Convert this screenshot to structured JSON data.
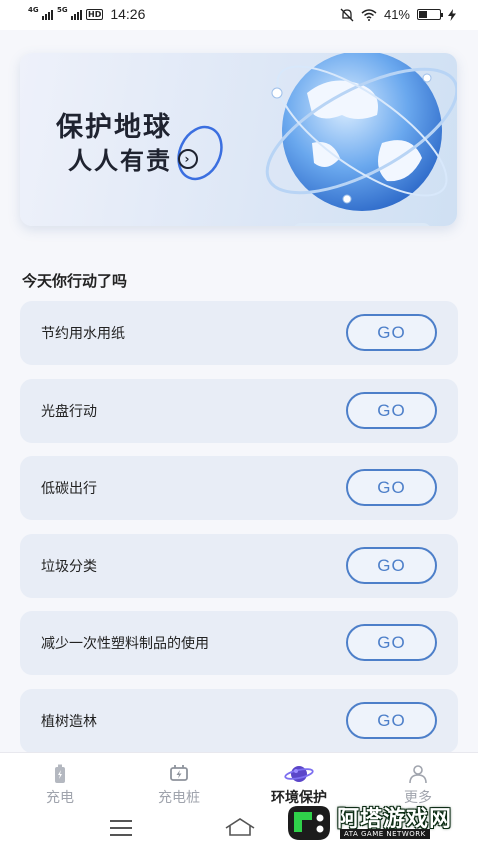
{
  "status_bar": {
    "net1": "4G",
    "net2": "5G",
    "hd": "HD",
    "time": "14:26",
    "battery_text": "41%",
    "battery_level": 0.41
  },
  "banner": {
    "title": "保护地球",
    "subtitle": "人人有责"
  },
  "section_title": "今天你行动了吗",
  "actions": [
    {
      "label": "节约用水用纸",
      "button": "GO"
    },
    {
      "label": "光盘行动",
      "button": "GO"
    },
    {
      "label": "低碳出行",
      "button": "GO"
    },
    {
      "label": "垃圾分类",
      "button": "GO"
    },
    {
      "label": "减少一次性塑料制品的使用",
      "button": "GO"
    },
    {
      "label": "植树造林",
      "button": "GO"
    }
  ],
  "tabs": [
    {
      "label": "充电",
      "icon": "battery-icon",
      "active": false
    },
    {
      "label": "充电桩",
      "icon": "charging-pile-icon",
      "active": false
    },
    {
      "label": "环境保护",
      "icon": "planet-icon",
      "active": true
    },
    {
      "label": "更多",
      "icon": "user-icon",
      "active": false
    }
  ],
  "watermark": {
    "text": "阿塔游戏网",
    "sub": "ATA GAME NETWORK"
  },
  "colors": {
    "accent": "#4d7fc9",
    "card_bg": "#e8edf6",
    "page_bg": "#f6f7fb"
  }
}
